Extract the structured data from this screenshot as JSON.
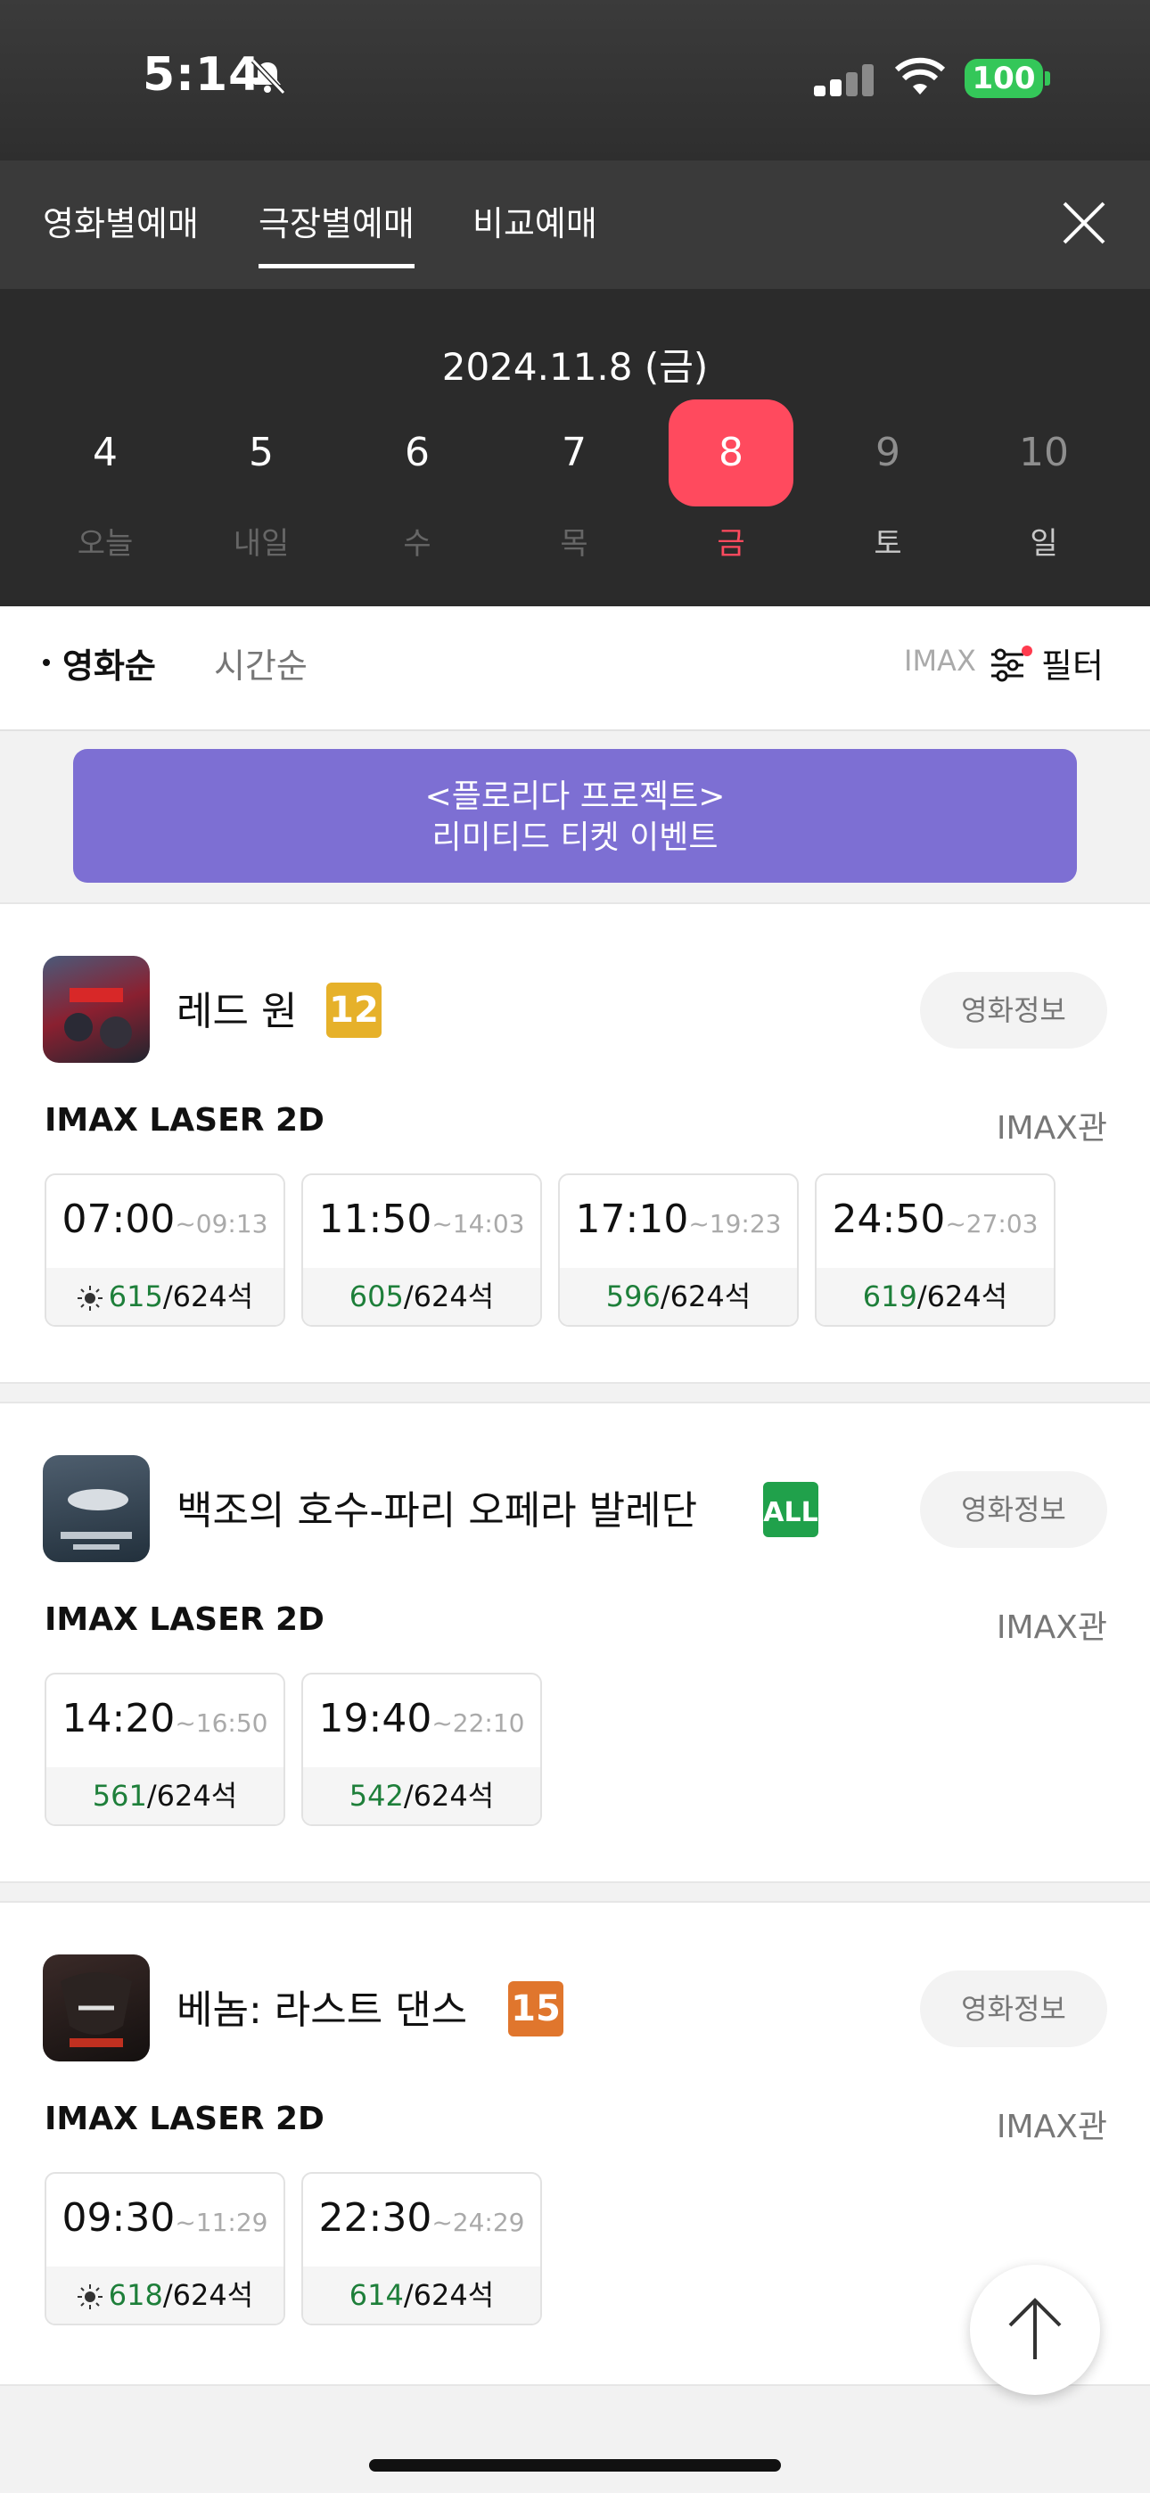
{
  "status": {
    "time": "5:14",
    "battery": "100"
  },
  "tabs": [
    {
      "label": "영화별예매"
    },
    {
      "label": "극장별예매",
      "active": true
    },
    {
      "label": "비교예매"
    }
  ],
  "date_title": "2024.11.8 (금)",
  "days": [
    {
      "num": "4",
      "label": "오늘"
    },
    {
      "num": "5",
      "label": "내일"
    },
    {
      "num": "6",
      "label": "수"
    },
    {
      "num": "7",
      "label": "목"
    },
    {
      "num": "8",
      "label": "금",
      "selected": true
    },
    {
      "num": "9",
      "label": "토"
    },
    {
      "num": "10",
      "label": "일"
    }
  ],
  "sort": {
    "by_movie": "영화순",
    "by_time": "시간순",
    "imax_filter": "IMAX",
    "filter": "필터"
  },
  "banner": {
    "line1": "<플로리다 프로젝트>",
    "line2": "리미티드 티켓 이벤트"
  },
  "movie_info_label": "영화정보",
  "movies": [
    {
      "title": "레드 원",
      "rating": "12",
      "rating_color": "#e6b12a",
      "format": "IMAX LASER 2D",
      "hall": "IMAX관",
      "showtimes": [
        {
          "start": "07:00",
          "end": "~09:13",
          "avail": "615",
          "total": "/624석",
          "morning": true
        },
        {
          "start": "11:50",
          "end": "~14:03",
          "avail": "605",
          "total": "/624석"
        },
        {
          "start": "17:10",
          "end": "~19:23",
          "avail": "596",
          "total": "/624석"
        },
        {
          "start": "24:50",
          "end": "~27:03",
          "avail": "619",
          "total": "/624석"
        }
      ]
    },
    {
      "title": "백조의 호수-파리 오페라 발레단",
      "rating": "ALL",
      "rating_color": "#20a14b",
      "format": "IMAX LASER 2D",
      "hall": "IMAX관",
      "showtimes": [
        {
          "start": "14:20",
          "end": "~16:50",
          "avail": "561",
          "total": "/624석"
        },
        {
          "start": "19:40",
          "end": "~22:10",
          "avail": "542",
          "total": "/624석"
        }
      ]
    },
    {
      "title": "베놈: 라스트 댄스",
      "rating": "15",
      "rating_color": "#e0762d",
      "format": "IMAX LASER 2D",
      "hall": "IMAX관",
      "showtimes": [
        {
          "start": "09:30",
          "end": "~11:29",
          "avail": "618",
          "total": "/624석",
          "morning": true
        },
        {
          "start": "22:30",
          "end": "~24:29",
          "avail": "614",
          "total": "/624석"
        }
      ]
    }
  ]
}
